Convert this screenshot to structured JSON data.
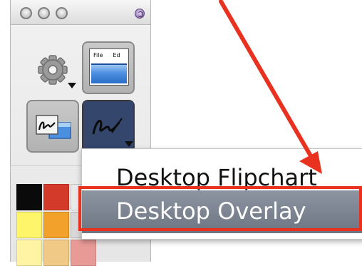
{
  "palette": {
    "tools": [
      {
        "name": "gear-settings",
        "icon": "gear-icon"
      },
      {
        "name": "desktop-window",
        "icon": "window-icon",
        "menu_labels": [
          "File",
          "Ed"
        ]
      },
      {
        "name": "annotate-desktop",
        "icon": "pen-on-desktop-icon"
      },
      {
        "name": "pen-mode",
        "icon": "pen-icon"
      }
    ],
    "colors": [
      "#0a0a0a",
      "#d43a2a",
      "#e9e9e9",
      "#fff56a",
      "#f2a12b",
      "#d8d8d8",
      "#fff3a4",
      "#f0c987",
      "#e89a96",
      "#f0c7c7"
    ]
  },
  "context_menu": {
    "items": [
      {
        "label": "Desktop Flipchart",
        "selected": false
      },
      {
        "label": "Desktop Overlay",
        "selected": true
      }
    ]
  },
  "annotations": {
    "arrow_color": "#e8321f",
    "highlight_color": "#e8321f"
  }
}
